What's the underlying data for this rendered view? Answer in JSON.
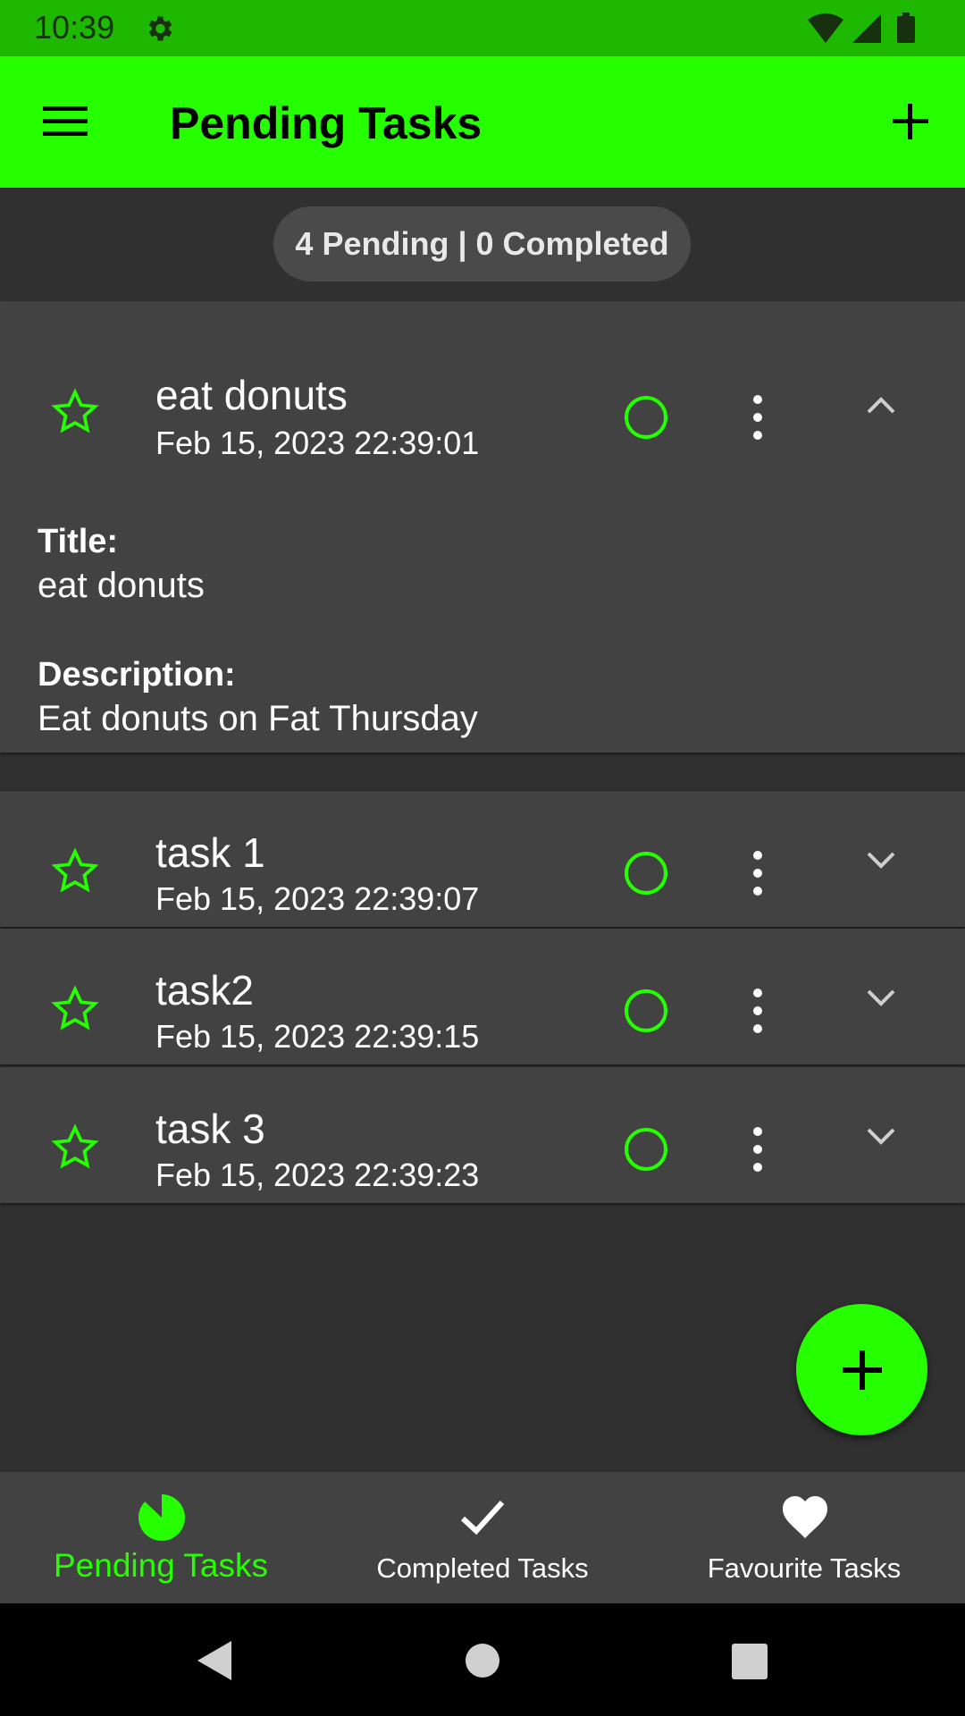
{
  "status_bar": {
    "time": "10:39",
    "icons": [
      "gear-icon",
      "wifi-icon",
      "signal-icon",
      "battery-icon"
    ]
  },
  "app_bar": {
    "title": "Pending Tasks",
    "menu_icon": "menu-icon",
    "add_icon": "add-icon"
  },
  "counter": {
    "text": "4 Pending | 0 Completed"
  },
  "tasks": [
    {
      "title": "eat donuts",
      "date": "Feb 15, 2023 22:39:01",
      "expanded": true,
      "detail_title_label": "Title:",
      "detail_title_value": "eat donuts",
      "detail_description_label": "Description:",
      "detail_description_value": "Eat donuts on Fat Thursday"
    },
    {
      "title": "task 1",
      "date": "Feb 15, 2023 22:39:07",
      "expanded": false
    },
    {
      "title": "task2",
      "date": "Feb 15, 2023 22:39:15",
      "expanded": false
    },
    {
      "title": "task 3",
      "date": "Feb 15, 2023 22:39:23",
      "expanded": false
    }
  ],
  "bottom_nav": {
    "items": [
      {
        "label": "Pending Tasks",
        "icon": "pie-icon",
        "active": true
      },
      {
        "label": "Completed Tasks",
        "icon": "check-icon",
        "active": false
      },
      {
        "label": "Favourite Tasks",
        "icon": "heart-icon",
        "active": false
      }
    ]
  },
  "colors": {
    "accent": "#26ff00",
    "status_bar": "#1fb800",
    "background": "#303030",
    "card": "#424242"
  }
}
